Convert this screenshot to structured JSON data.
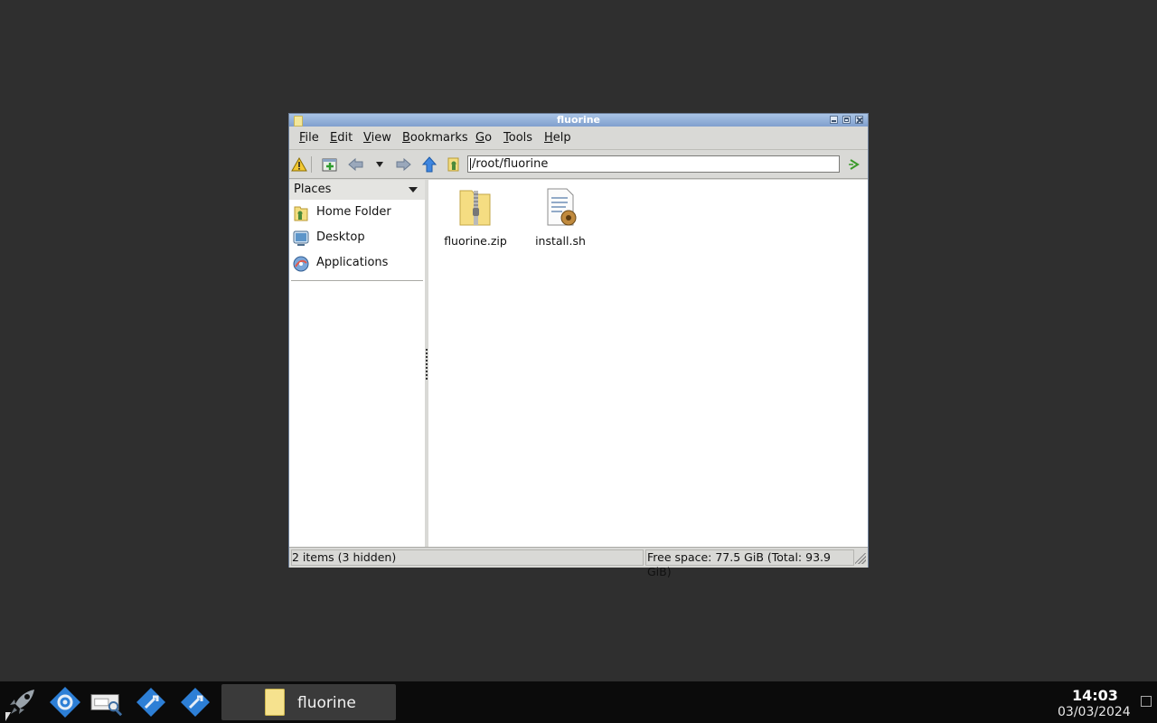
{
  "window": {
    "title": "fluorine",
    "menu": [
      "File",
      "Edit",
      "View",
      "Bookmarks",
      "Go",
      "Tools",
      "Help"
    ],
    "path": "/root/fluorine"
  },
  "sidebar": {
    "header": "Places",
    "items": [
      {
        "label": "Home Folder",
        "icon": "home-folder-icon"
      },
      {
        "label": "Desktop",
        "icon": "desktop-icon"
      },
      {
        "label": "Applications",
        "icon": "applications-icon"
      }
    ]
  },
  "files": [
    {
      "name": "fluorine.zip",
      "icon": "zip-folder-icon"
    },
    {
      "name": "install.sh",
      "icon": "shell-script-icon"
    }
  ],
  "status": {
    "items": "2 items (3 hidden)",
    "space": "Free space: 77.5 GiB (Total: 93.9 GiB)"
  },
  "taskbar": {
    "task_label": "fluorine",
    "time": "14:03",
    "date": "03/03/2024"
  },
  "colors": {
    "titlebar": "#7f9fcd",
    "desktop": "#2f2f2f",
    "taskbar": "#0b0b0b",
    "folder": "#f6e28e"
  }
}
